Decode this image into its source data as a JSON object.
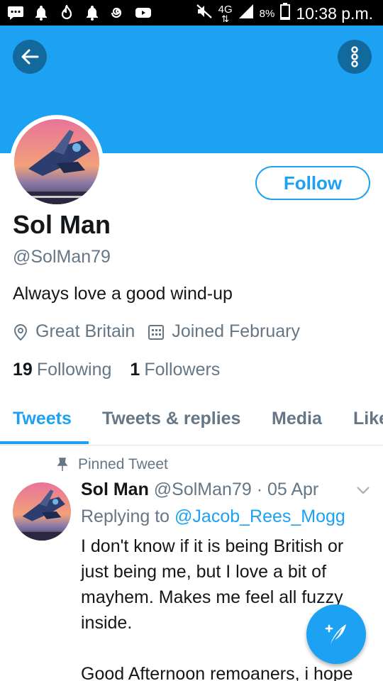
{
  "status_bar": {
    "network": "4G",
    "battery": "8%",
    "time": "10:38 p.m."
  },
  "profile": {
    "display_name": "Sol Man",
    "handle": "@SolMan79",
    "bio": "Always love a good wind-up",
    "location": "Great Britain",
    "joined": "Joined February",
    "following_count": "19",
    "following_label": "Following",
    "followers_count": "1",
    "followers_label": "Followers",
    "follow_button": "Follow"
  },
  "tabs": [
    {
      "label": "Tweets"
    },
    {
      "label": "Tweets & replies"
    },
    {
      "label": "Media"
    },
    {
      "label": "Likes"
    }
  ],
  "pinned_tweet": {
    "pinned_label": "Pinned Tweet",
    "author": "Sol Man",
    "handle": "@SolMan79",
    "date": "· 05 Apr",
    "replying_prefix": "Replying to",
    "replying_to": "@Jacob_Rees_Mogg",
    "text_1": "I don't know if it is being British or just being me, but I love a bit of mayhem. Makes me feel all fuzzy inside.",
    "text_2": "Good Afternoon remoaners, i hope"
  },
  "colors": {
    "accent": "#1da1f2",
    "secondary_text": "#657786"
  }
}
